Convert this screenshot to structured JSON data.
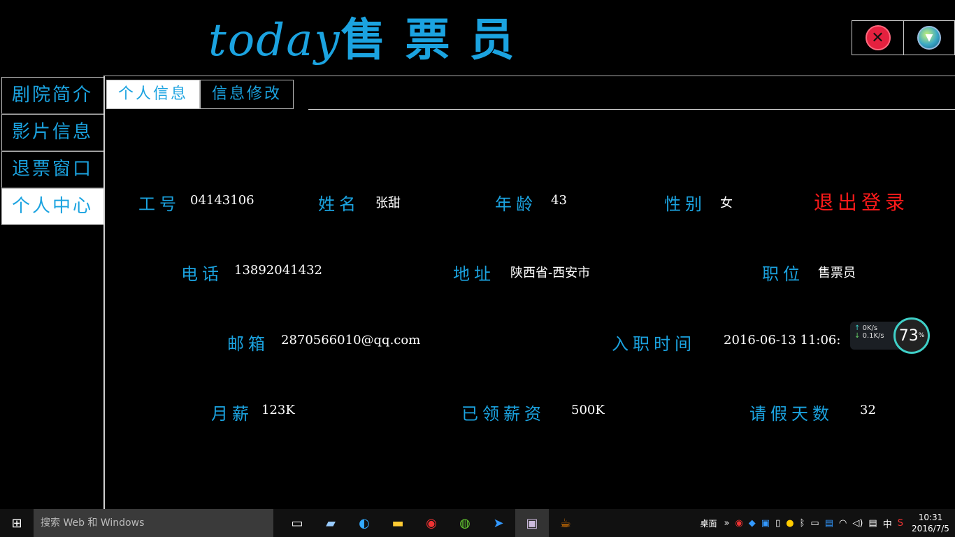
{
  "header": {
    "title_latin": "today",
    "title_cn": "售票员"
  },
  "sidebar": {
    "items": [
      {
        "label": "剧院简介"
      },
      {
        "label": "影片信息"
      },
      {
        "label": "退票窗口"
      },
      {
        "label": "个人中心"
      }
    ]
  },
  "tabs": [
    {
      "label": "个人信息"
    },
    {
      "label": "信息修改"
    }
  ],
  "info": {
    "id_label": "工号",
    "id_value": "04143106",
    "name_label": "姓名",
    "name_value": "张甜",
    "age_label": "年龄",
    "age_value": "43",
    "gender_label": "性别",
    "gender_value": "女",
    "logout": "退出登录",
    "phone_label": "电话",
    "phone_value": "13892041432",
    "address_label": "地址",
    "address_value": "陕西省-西安市",
    "position_label": "职位",
    "position_value": "售票员",
    "email_label": "邮箱",
    "email_value": "2870566010@qq.com",
    "hire_label": "入职时间",
    "hire_value": "2016-06-13 11:06:",
    "salary_label": "月薪",
    "salary_value": "123K",
    "paid_label": "已领薪资",
    "paid_value": "500K",
    "leave_label": "请假天数",
    "leave_value": "32"
  },
  "net_widget": {
    "up": "0",
    "up_unit": "K/s",
    "down": "0.1",
    "down_unit": "K/s",
    "percent": "73",
    "percent_sign": "%"
  },
  "taskbar": {
    "search_placeholder": "搜索 Web 和 Windows",
    "desktop": "桌面",
    "lang": "中",
    "time": "10:31",
    "date": "2016/7/5"
  },
  "colors": {
    "accent": "#1ba3e0",
    "logout": "#ff1a1a"
  }
}
